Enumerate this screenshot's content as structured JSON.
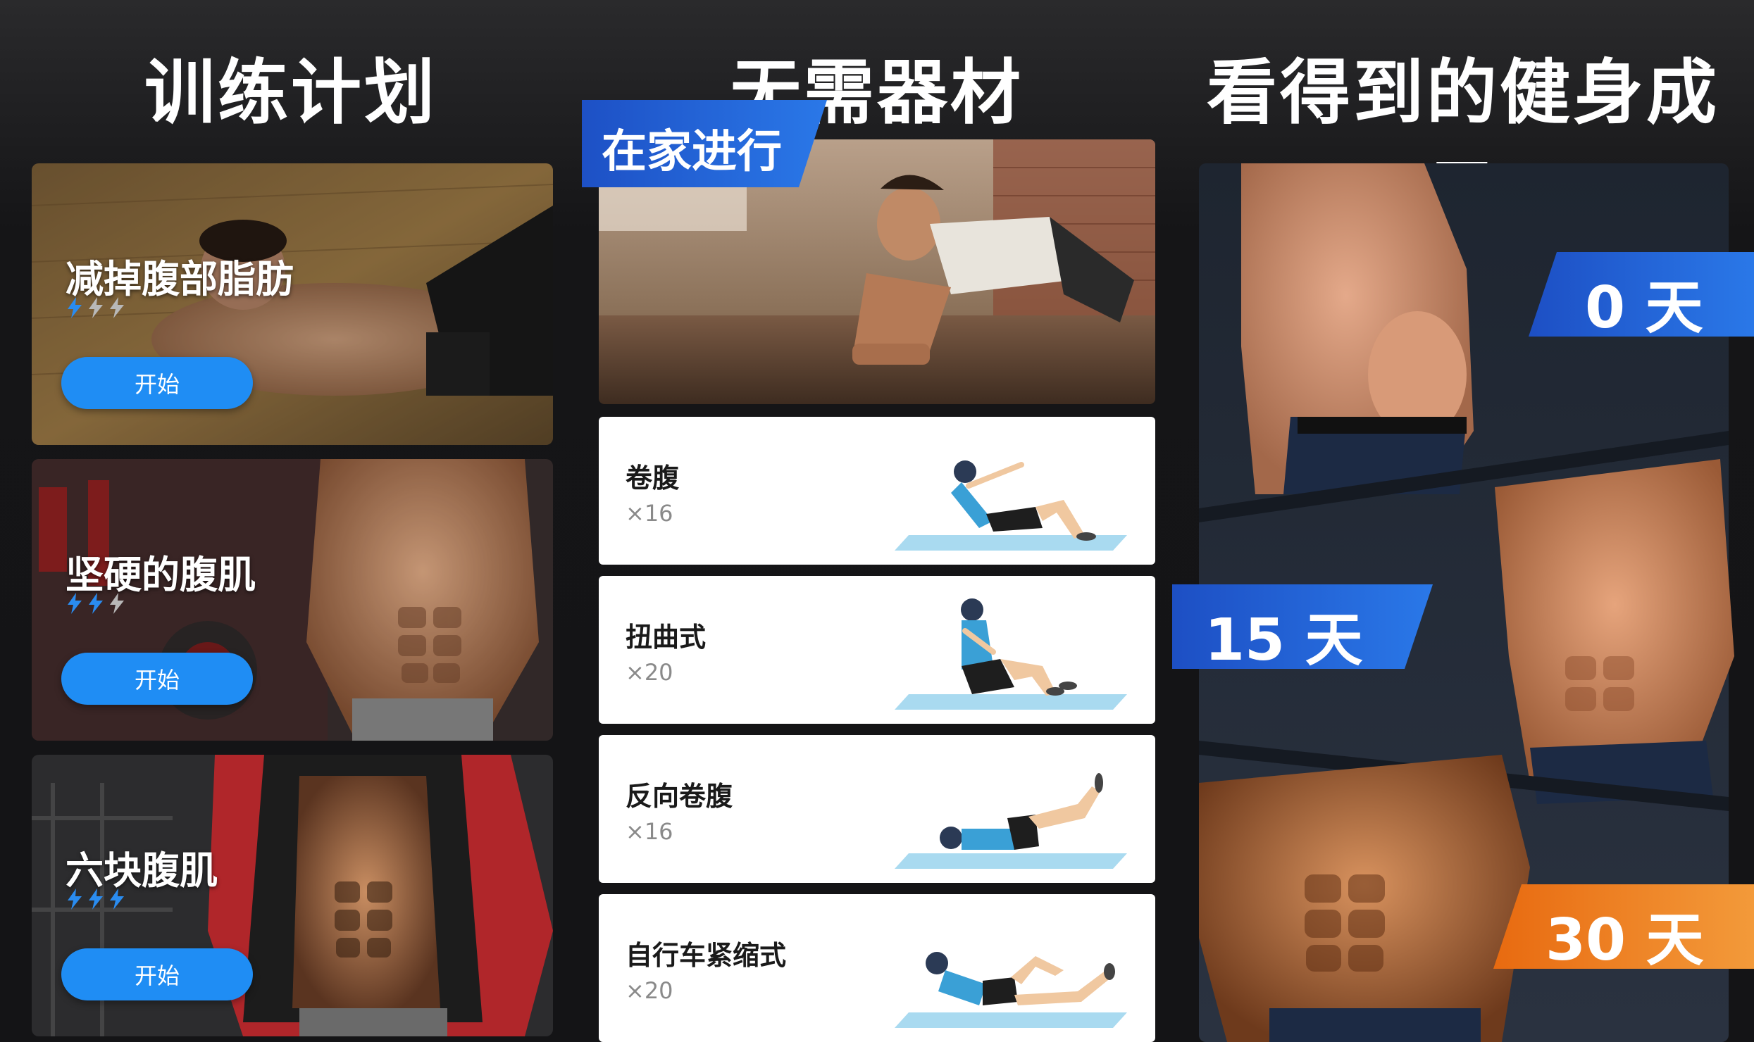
{
  "panel1": {
    "heading": "训练计划",
    "plans": [
      {
        "title": "减掉腹部脂肪",
        "level": 1,
        "max_level": 3,
        "button": "开始"
      },
      {
        "title": "坚硬的腹肌",
        "level": 2,
        "max_level": 3,
        "button": "开始"
      },
      {
        "title": "六块腹肌",
        "level": 3,
        "max_level": 3,
        "button": "开始"
      }
    ]
  },
  "panel2": {
    "heading": "无需器材",
    "banner": "在家进行",
    "exercises": [
      {
        "name": "卷腹",
        "reps": "×16"
      },
      {
        "name": "扭曲式",
        "reps": "×20"
      },
      {
        "name": "反向卷腹",
        "reps": "×16"
      },
      {
        "name": "自行车紧缩式",
        "reps": "×20"
      }
    ]
  },
  "panel3": {
    "heading": "看得到的健身成果",
    "days": [
      {
        "label": "0 天"
      },
      {
        "label": "15 天"
      },
      {
        "label": "30 天"
      }
    ]
  },
  "colors": {
    "accent_blue": "#1f8df4",
    "banner_blue": "#1f5fd6",
    "banner_orange": "#f07a1c",
    "bolt_active": "#2a8cf0",
    "bolt_inactive": "#b8b8b8"
  }
}
